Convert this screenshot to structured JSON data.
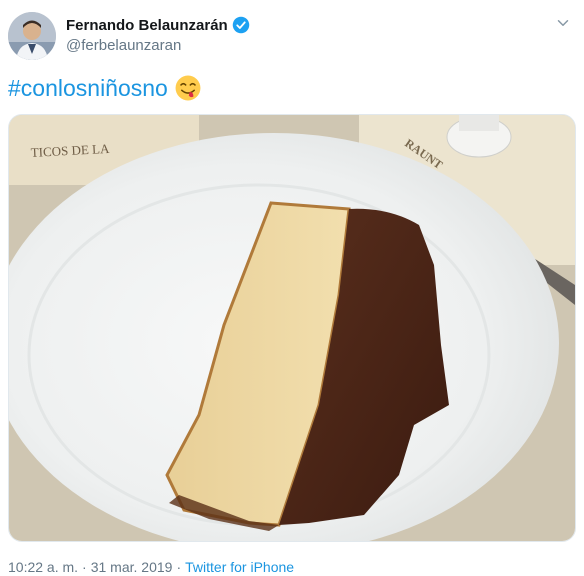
{
  "author": {
    "display_name": "Fernando Belaunzarán",
    "handle": "@ferbelaunzaran",
    "verified": true
  },
  "tweet": {
    "hashtag": "#conlosniñosno",
    "emoji": "face-savoring-food-emoji"
  },
  "media": {
    "menu_fragment": "TICOS DE LA",
    "stamp_fragment": "RAUNT"
  },
  "footer": {
    "time": "10:22 a. m.",
    "separator": "·",
    "date": "31 mar. 2019",
    "source": "Twitter for iPhone"
  },
  "colors": {
    "link": "#1b95e0",
    "secondary_text": "#657786",
    "verified_badge": "#1da1f2"
  }
}
